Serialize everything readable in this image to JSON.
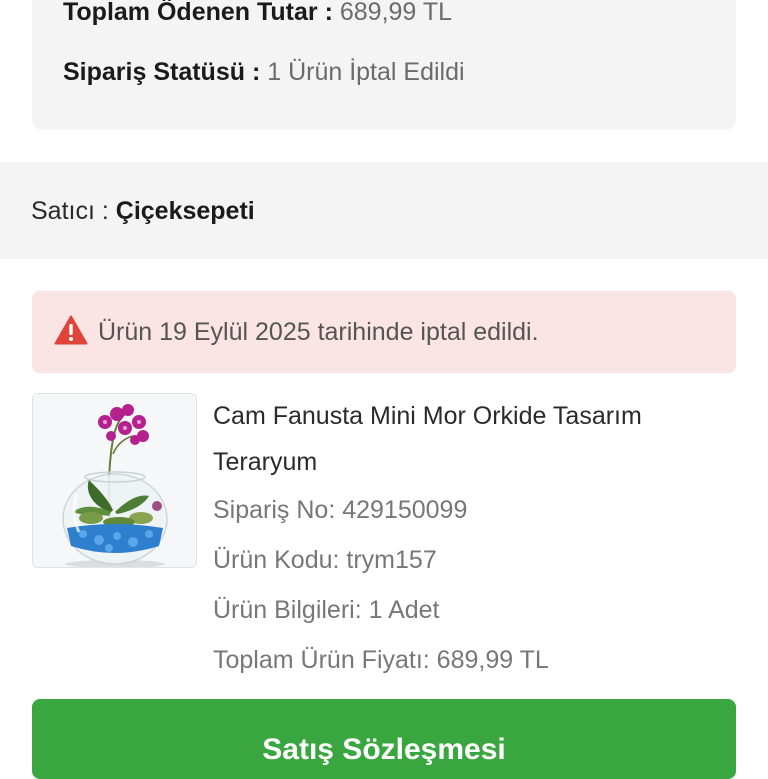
{
  "order_summary": {
    "total_paid_label": "Toplam Ödenen Tutar : ",
    "total_paid_value": "689,99 TL",
    "status_label": "Sipariş Statüsü : ",
    "status_value": "1 Ürün İptal Edildi"
  },
  "seller": {
    "label": "Satıcı : ",
    "name": "Çiçeksepeti"
  },
  "alert": {
    "icon": "warning-triangle-icon",
    "color": "#e0433a",
    "text": "Ürün 19 Eylül 2025 tarihinde iptal edildi."
  },
  "product": {
    "title": "Cam Fanusta Mini Mor Orkide Tasarım Teraryum",
    "order_no": "Sipariş No: 429150099",
    "product_code": "Ürün Kodu: trym157",
    "product_info": "Ürün Bilgileri: 1 Adet",
    "total_price": "Toplam Ürün Fiyatı: 689,99 TL"
  },
  "actions": {
    "contract_button_label": "Satış Sözleşmesi",
    "button_color": "#3aa63f"
  }
}
